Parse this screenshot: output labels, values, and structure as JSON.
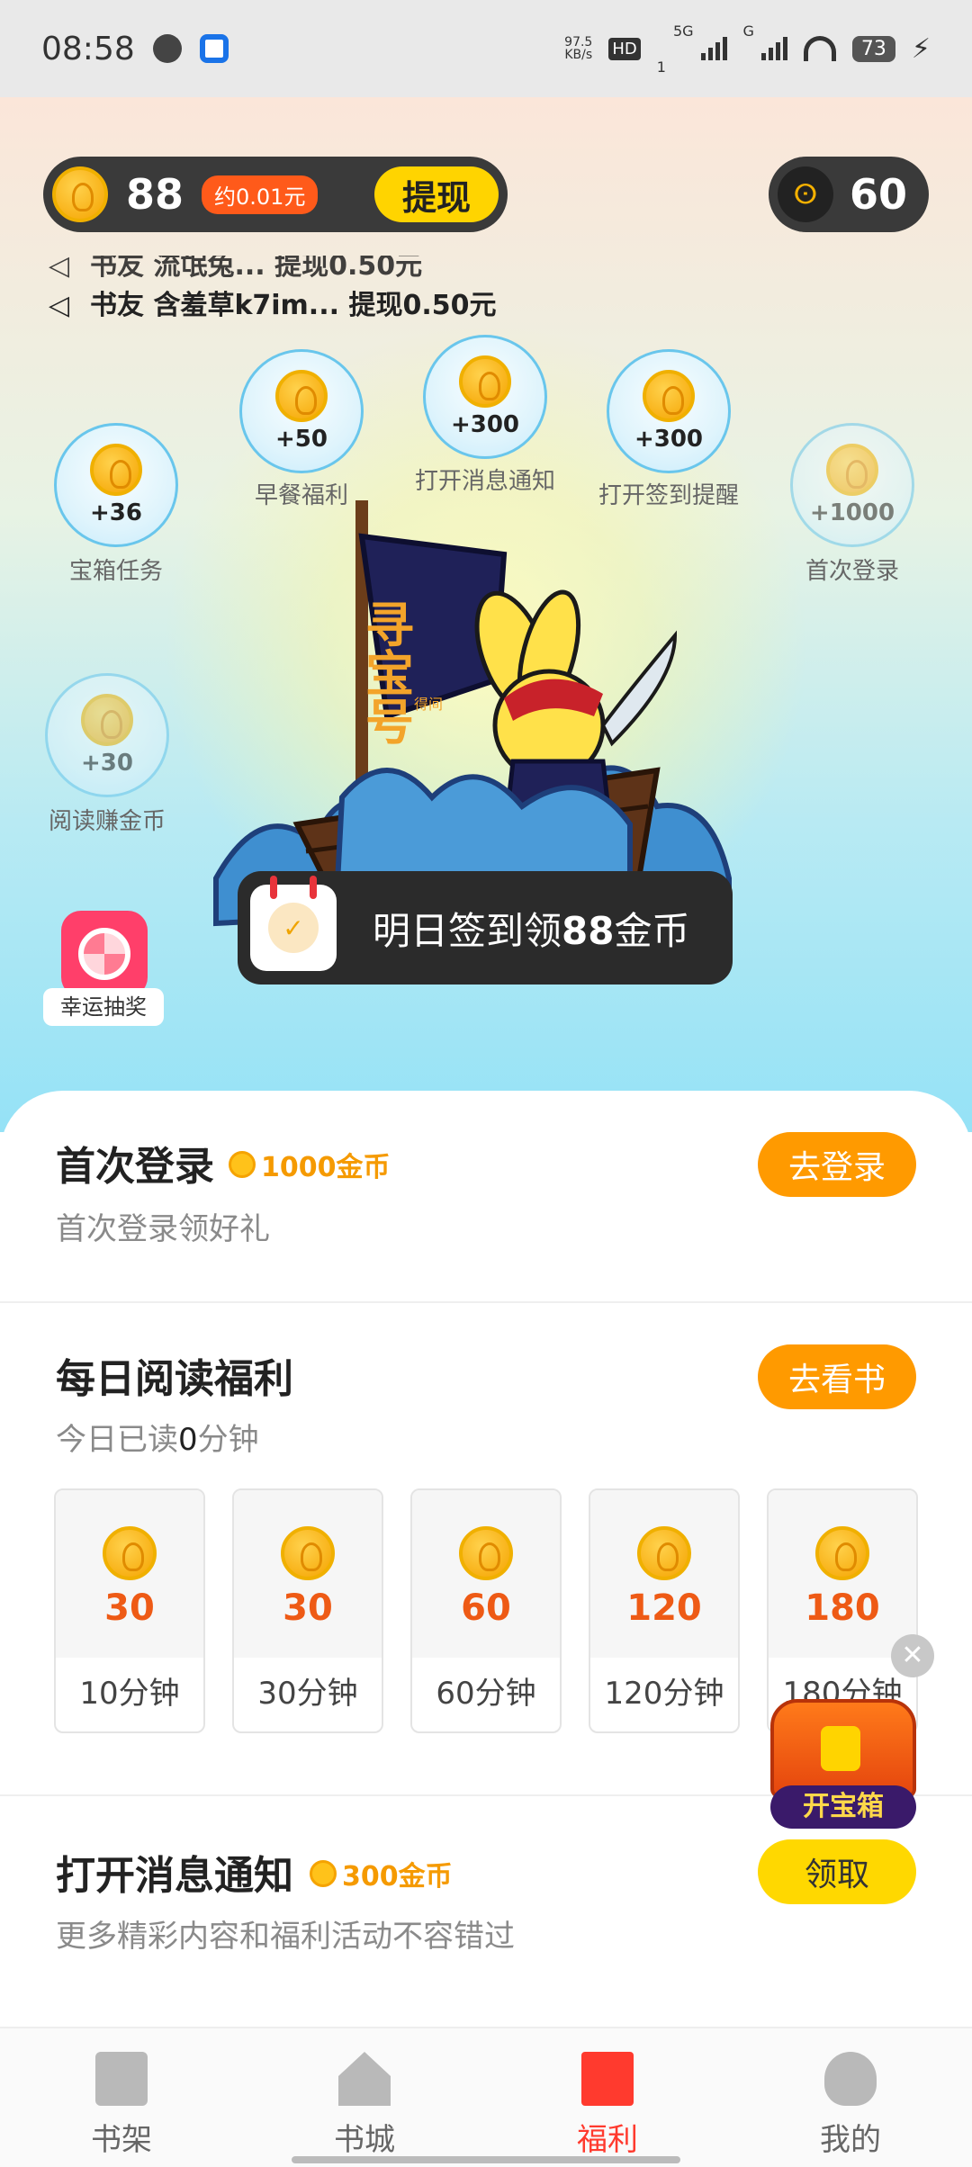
{
  "status_bar": {
    "time": "08:58",
    "net_speed": "97.5",
    "net_speed_unit": "KB/s",
    "hd": "HD",
    "sim1": "1",
    "net_5g": "5G",
    "net_g": "G",
    "battery": "73"
  },
  "wallet": {
    "coins": "88",
    "approx": "约0.01元",
    "withdraw_label": "提现",
    "vip_count": "60"
  },
  "ticker": {
    "line1": "书友 流氓兔... 提现0.50元",
    "line2": "书友 含羞草k7im... 提现0.50元"
  },
  "bubbles": [
    {
      "amount": "+36",
      "label": "宝箱任务"
    },
    {
      "amount": "+50",
      "label": "早餐福利"
    },
    {
      "amount": "+300",
      "label": "打开消息通知"
    },
    {
      "amount": "+300",
      "label": "打开签到提醒"
    },
    {
      "amount": "+1000",
      "label": "首次登录"
    },
    {
      "amount": "+30",
      "label": "阅读赚金币"
    }
  ],
  "ship": {
    "sail_text": "寻宝号",
    "sail_sub": "得间"
  },
  "toast": {
    "prefix": "明日签到领",
    "amount": "88",
    "suffix": "金币"
  },
  "lucky": {
    "label": "幸运抽奖"
  },
  "first_login": {
    "title": "首次登录",
    "reward": "1000金币",
    "subtitle": "首次登录领好礼",
    "button": "去登录"
  },
  "daily_read": {
    "title": "每日阅读福利",
    "subtitle_prefix": "今日已读",
    "minutes": "0",
    "subtitle_suffix": "分钟",
    "button": "去看书",
    "tiles": [
      {
        "coins": "30",
        "mins": "10分钟"
      },
      {
        "coins": "30",
        "mins": "30分钟"
      },
      {
        "coins": "60",
        "mins": "60分钟"
      },
      {
        "coins": "120",
        "mins": "120分钟"
      },
      {
        "coins": "180",
        "mins": "180分钟"
      }
    ]
  },
  "chest": {
    "label": "开宝箱",
    "close": "✕"
  },
  "notify": {
    "title": "打开消息通知",
    "reward": "300金币",
    "subtitle": "更多精彩内容和福利活动不容错过",
    "button": "领取"
  },
  "nav": [
    {
      "label": "书架"
    },
    {
      "label": "书城"
    },
    {
      "label": "福利"
    },
    {
      "label": "我的"
    }
  ]
}
